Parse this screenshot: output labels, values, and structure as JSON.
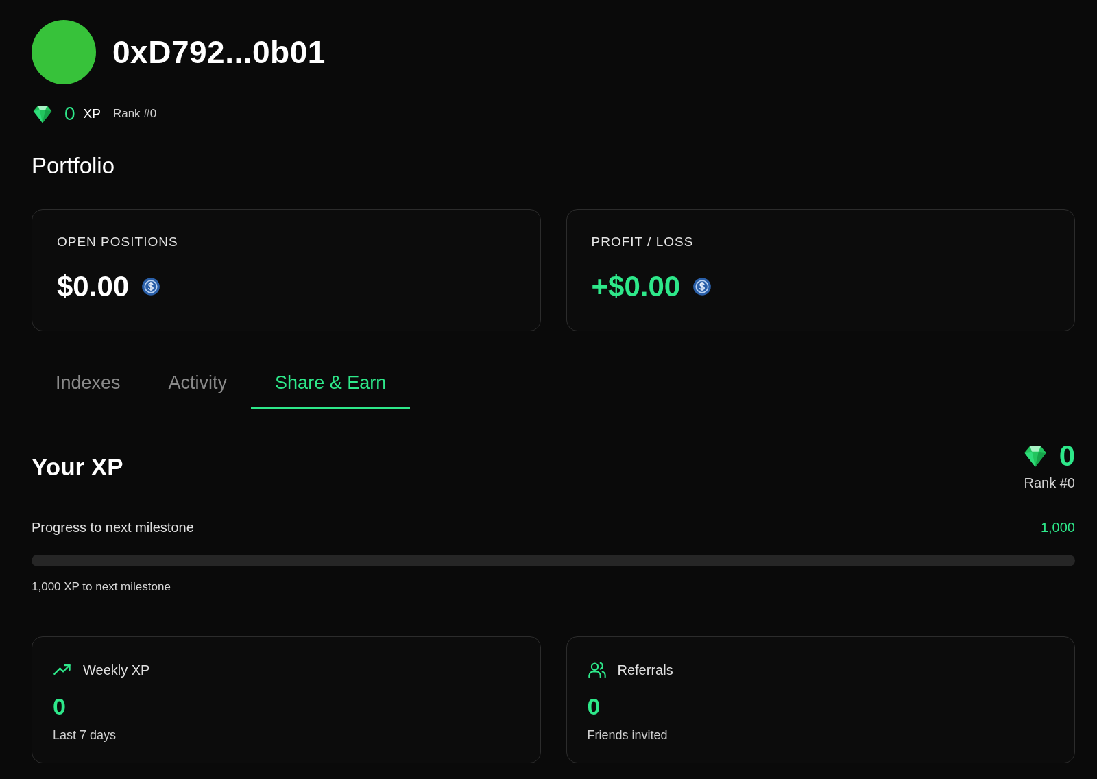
{
  "profile": {
    "address": "0xD792...0b01",
    "xp_value": "0",
    "xp_unit": "XP",
    "rank": "Rank #0"
  },
  "portfolio": {
    "title": "Portfolio",
    "cards": [
      {
        "label": "OPEN POSITIONS",
        "value": "$0.00",
        "kind": "neutral"
      },
      {
        "label": "PROFIT / LOSS",
        "value": "+$0.00",
        "kind": "gain"
      }
    ]
  },
  "tabs": [
    {
      "label": "Indexes",
      "selected": false
    },
    {
      "label": "Activity",
      "selected": false
    },
    {
      "label": "Share & Earn",
      "selected": true
    }
  ],
  "xp": {
    "title": "Your XP",
    "total": "0",
    "rank": "Rank #0",
    "progress_label": "Progress to next milestone",
    "milestone": "1,000",
    "level": 0,
    "remaining": "1,000 XP to next milestone"
  },
  "stats": [
    {
      "kind": "trend",
      "label": "Weekly XP",
      "value": "0",
      "caption": "Last 7 days"
    },
    {
      "kind": "people",
      "label": "Referrals",
      "value": "0",
      "caption": "Friends invited"
    }
  ]
}
